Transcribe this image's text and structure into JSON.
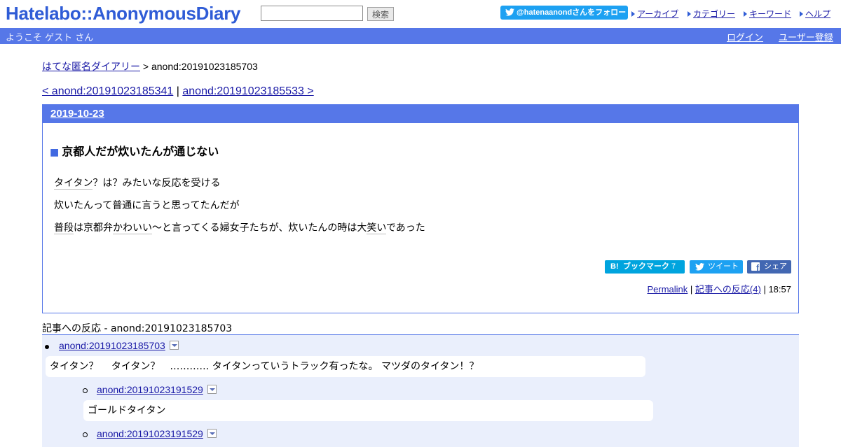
{
  "header": {
    "logo": "Hatelabo::AnonymousDiary",
    "search_value": "",
    "search_button": "検索",
    "follow_button": "@hatenaanondさんをフォロー",
    "links": [
      "アーカイブ",
      "カテゴリー",
      "キーワード",
      "ヘルプ"
    ]
  },
  "bar": {
    "welcome": "ようこそ ゲスト さん",
    "login": "ログイン",
    "register": "ユーザー登録"
  },
  "breadcrumb": {
    "home": "はてな匿名ダイアリー",
    "sep": ">",
    "current": "anond:20191023185703"
  },
  "pager": {
    "prev": "< anond:20191023185341",
    "sep": "|",
    "next": "anond:20191023185533 >"
  },
  "entry": {
    "date": "2019-10-23",
    "title_mark": "■",
    "title": "京都人だが炊いたんが通じない",
    "line1_kw": "タイタン",
    "line1_rest": "？は？みたいな反応を受ける",
    "line2": "炊いたんって普通に言うと思ってたんだが",
    "line3_kw1": "普段",
    "line3_mid1": "は京都弁",
    "line3_kw2": "かわいい",
    "line3_mid2": "〜と言ってくる婦女子たちが、炊いたんの時は大",
    "line3_kw3": "笑い",
    "line3_end": "であった",
    "share": {
      "hatena_icon": "B!",
      "hatena": "ブックマーク",
      "hatena_count": "7",
      "tweet": "ツイート",
      "facebook_icon": "f",
      "facebook": "シェア"
    },
    "footer": {
      "permalink": "Permalink",
      "sep1": "|",
      "reactions": "記事への反応(4)",
      "sep2": "|",
      "time": "18:57"
    }
  },
  "reactions": {
    "heading": "記事への反応 - anond:20191023185703",
    "items": [
      {
        "id": "anond:20191023185703",
        "text": "タイタン？　 タイタン？　…………  タイタンっていうトラック有ったな。 マツダのタイタン！？"
      },
      {
        "id": "anond:20191023191529",
        "text": "ゴールドタイタン"
      },
      {
        "id": "anond:20191023191529",
        "text": ""
      }
    ]
  }
}
